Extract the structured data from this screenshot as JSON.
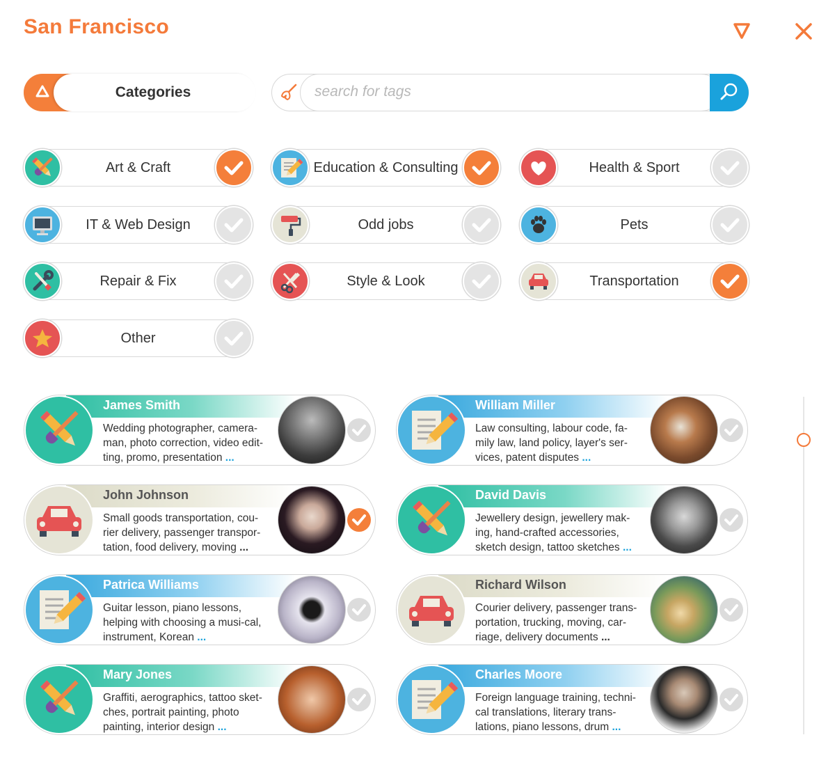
{
  "header": {
    "title": "San Francisco"
  },
  "categories_pill": {
    "label": "Categories"
  },
  "search": {
    "placeholder": "search for tags",
    "value": ""
  },
  "categories": [
    {
      "label": "Art & Craft",
      "icon": "paint-brush-pencil-icon",
      "checked": true
    },
    {
      "label": "Education & Consulting",
      "icon": "document-pencil-icon",
      "checked": true
    },
    {
      "label": "Health & Sport",
      "icon": "heart-icon",
      "checked": false
    },
    {
      "label": "IT & Web Design",
      "icon": "monitor-icon",
      "checked": false
    },
    {
      "label": "Odd jobs",
      "icon": "paint-roller-icon",
      "checked": false
    },
    {
      "label": "Pets",
      "icon": "paw-icon",
      "checked": false
    },
    {
      "label": "Repair & Fix",
      "icon": "wrench-screwdriver-icon",
      "checked": false
    },
    {
      "label": "Style & Look",
      "icon": "scissors-comb-icon",
      "checked": false
    },
    {
      "label": "Transportation",
      "icon": "car-icon",
      "checked": true
    },
    {
      "label": "Other",
      "icon": "star-icon",
      "checked": false
    }
  ],
  "profiles": [
    {
      "name": "James Smith",
      "description": "Wedding photographer, camera-man, photo correction, video edit-ting, promo, presentation",
      "category": "art",
      "checked": false,
      "more": "..."
    },
    {
      "name": "William Miller",
      "description": "Law consulting, labour code, fa-mily law, land policy, layer's ser-vices, patent disputes",
      "category": "education",
      "checked": false,
      "more": "..."
    },
    {
      "name": "John Johnson",
      "description": "Small goods transportation, cou-rier delivery, passenger transpor-tation, food delivery, moving",
      "category": "transport",
      "checked": true,
      "more": "..."
    },
    {
      "name": "David Davis",
      "description": "Jewellery design, jewellery mak-ing, hand-crafted accessories, sketch design, tattoo sketches",
      "category": "art",
      "checked": false,
      "more": "..."
    },
    {
      "name": "Patrica Williams",
      "description": "Guitar lesson, piano lessons, helping with choosing a musi-cal, instrument, Korean",
      "category": "education",
      "checked": false,
      "more": "..."
    },
    {
      "name": "Richard Wilson",
      "description": "Courier delivery, passenger trans-portation, trucking, moving, car-riage,  delivery documents",
      "category": "transport",
      "checked": false,
      "more": "..."
    },
    {
      "name": "Mary Jones",
      "description": "Graffiti, aerographics, tattoo sket-ches, portrait painting, photo painting, interior design",
      "category": "art",
      "checked": false,
      "more": "..."
    },
    {
      "name": "Charles Moore",
      "description": "Foreign language training, techni-cal translations, literary trans-lations, piano lessons, drum",
      "category": "education",
      "checked": false,
      "more": "..."
    }
  ],
  "colors": {
    "accent": "#f47a3a",
    "blue": "#1aa2dc",
    "teal": "#2fbfa3",
    "unchecked": "#e4e4e4"
  }
}
